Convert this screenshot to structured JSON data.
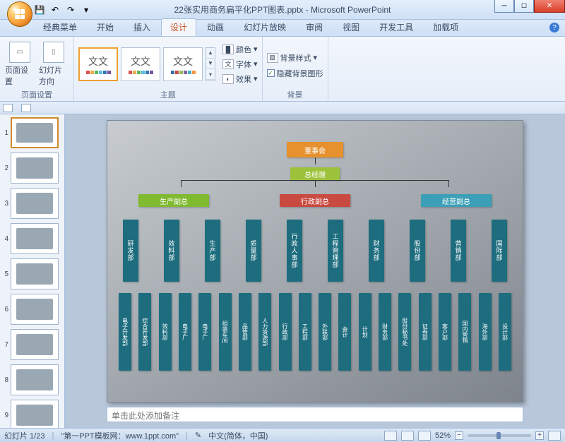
{
  "window": {
    "doc_title": "22张实用商务扁平化PPT图表.pptx",
    "app_name": "Microsoft PowerPoint"
  },
  "qat": {
    "save": "💾",
    "undo": "↶",
    "redo": "↷",
    "print": "▾"
  },
  "tabs": {
    "classic": "经典菜单",
    "home": "开始",
    "insert": "插入",
    "design": "设计",
    "anim": "动画",
    "slideshow": "幻灯片放映",
    "review": "审阅",
    "view": "视图",
    "dev": "开发工具",
    "addin": "加载项"
  },
  "ribbon": {
    "page_setup_group": "页面设置",
    "page_setup_btn": "页面设置",
    "slide_orient_btn": "幻灯片方向",
    "themes_group": "主题",
    "theme_aa": "文文",
    "colors": "颜色",
    "fonts": "字体",
    "effects": "效果",
    "bg_group": "背景",
    "bg_styles": "背景样式",
    "hide_bg": "隐藏背景图形"
  },
  "slide": {
    "org": {
      "lvl1": "董事会",
      "lvl2": "总经理",
      "lvl3": [
        "生产副总",
        "行政副总",
        "经营副总"
      ],
      "lvl4": [
        "研发部",
        "效料部",
        "生产部",
        "质量部",
        "行政人事部",
        "工程管理部",
        "财务部",
        "股份部",
        "营销部",
        "国际部"
      ],
      "lvl5": [
        "电子开发部",
        "综合开发部",
        "效料部",
        "电子厂",
        "电子厂",
        "组装车间",
        "品管部",
        "人力资源部",
        "行政部",
        "工程部",
        "外联部",
        "会计",
        "计划",
        "财务部",
        "股份秘书处",
        "证券部",
        "客户部",
        "国内营销",
        "海外部",
        "设计部"
      ]
    }
  },
  "thumb_count": 9,
  "notes_placeholder": "单击此处添加备注",
  "status": {
    "slide_counter": "幻灯片 1/23",
    "site": "\"第一PPT模板网：www.1ppt.com\"",
    "lang": "中文(简体，中国)",
    "zoom": "52%"
  }
}
